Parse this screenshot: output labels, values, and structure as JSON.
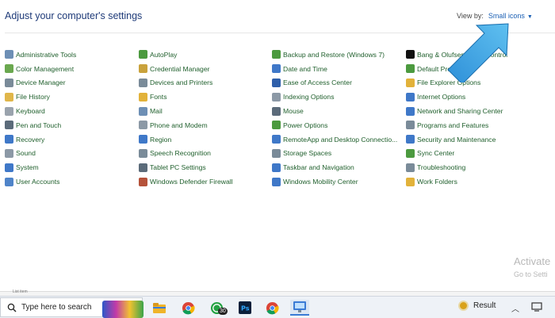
{
  "header": {
    "title": "Adjust your computer's settings"
  },
  "view_by": {
    "label": "View by:",
    "value": "Small icons"
  },
  "columns": [
    {
      "items": [
        {
          "label": "Administrative Tools",
          "icon": "admin-tools-icon",
          "color": "#6d8fb5"
        },
        {
          "label": "Color Management",
          "icon": "color-management-icon",
          "color": "#6aa84f"
        },
        {
          "label": "Device Manager",
          "icon": "device-manager-icon",
          "color": "#7a8b99"
        },
        {
          "label": "File History",
          "icon": "file-history-icon",
          "color": "#e0b64a"
        },
        {
          "label": "Keyboard",
          "icon": "keyboard-icon",
          "color": "#9aa3ad"
        },
        {
          "label": "Pen and Touch",
          "icon": "pen-icon",
          "color": "#5b6b7a"
        },
        {
          "label": "Recovery",
          "icon": "recovery-icon",
          "color": "#3f78c8"
        },
        {
          "label": "Sound",
          "icon": "sound-icon",
          "color": "#8c99a6"
        },
        {
          "label": "System",
          "icon": "system-icon",
          "color": "#3f78c8"
        },
        {
          "label": "User Accounts",
          "icon": "user-accounts-icon",
          "color": "#4f84c9"
        }
      ]
    },
    {
      "items": [
        {
          "label": "AutoPlay",
          "icon": "autoplay-icon",
          "color": "#4c9a3f"
        },
        {
          "label": "Credential Manager",
          "icon": "credential-manager-icon",
          "color": "#c9a23c"
        },
        {
          "label": "Devices and Printers",
          "icon": "printer-icon",
          "color": "#7a8b99"
        },
        {
          "label": "Fonts",
          "icon": "fonts-icon",
          "color": "#e2b23a"
        },
        {
          "label": "Mail",
          "icon": "mail-icon",
          "color": "#6d8fb5"
        },
        {
          "label": "Phone and Modem",
          "icon": "phone-icon",
          "color": "#8c99a6"
        },
        {
          "label": "Region",
          "icon": "region-icon",
          "color": "#3f78c8"
        },
        {
          "label": "Speech Recognition",
          "icon": "microphone-icon",
          "color": "#7a8b99"
        },
        {
          "label": "Tablet PC Settings",
          "icon": "tablet-icon",
          "color": "#5b6b7a"
        },
        {
          "label": "Windows Defender Firewall",
          "icon": "firewall-icon",
          "color": "#b5523a"
        }
      ]
    },
    {
      "items": [
        {
          "label": "Backup and Restore (Windows 7)",
          "icon": "backup-icon",
          "color": "#4c9a3f"
        },
        {
          "label": "Date and Time",
          "icon": "clock-icon",
          "color": "#3f78c8"
        },
        {
          "label": "Ease of Access Center",
          "icon": "ease-of-access-icon",
          "color": "#2f5faa"
        },
        {
          "label": "Indexing Options",
          "icon": "indexing-icon",
          "color": "#8c99a6"
        },
        {
          "label": "Mouse",
          "icon": "mouse-icon",
          "color": "#5b6b7a"
        },
        {
          "label": "Power Options",
          "icon": "power-icon",
          "color": "#4c9a3f"
        },
        {
          "label": "RemoteApp and Desktop Connectio...",
          "icon": "remote-desktop-icon",
          "color": "#3f78c8"
        },
        {
          "label": "Storage Spaces",
          "icon": "storage-icon",
          "color": "#7a8b99"
        },
        {
          "label": "Taskbar and Navigation",
          "icon": "taskbar-icon",
          "color": "#3f78c8"
        },
        {
          "label": "Windows Mobility Center",
          "icon": "mobility-center-icon",
          "color": "#3f78c8"
        }
      ]
    },
    {
      "items": [
        {
          "label": "Bang & Olufsen Audio Control",
          "icon": "bang-olufsen-icon",
          "color": "#222222"
        },
        {
          "label": "Default Programs",
          "icon": "default-programs-icon",
          "color": "#4c9a3f"
        },
        {
          "label": "File Explorer Options",
          "icon": "folder-icon",
          "color": "#e2b23a"
        },
        {
          "label": "Internet Options",
          "icon": "internet-icon",
          "color": "#3f78c8"
        },
        {
          "label": "Network and Sharing Center",
          "icon": "network-icon",
          "color": "#3f78c8"
        },
        {
          "label": "Programs and Features",
          "icon": "programs-icon",
          "color": "#7a8b99"
        },
        {
          "label": "Security and Maintenance",
          "icon": "flag-icon",
          "color": "#3f78c8"
        },
        {
          "label": "Sync Center",
          "icon": "sync-icon",
          "color": "#4c9a3f"
        },
        {
          "label": "Troubleshooting",
          "icon": "troubleshooting-icon",
          "color": "#7a8b99"
        },
        {
          "label": "Work Folders",
          "icon": "work-folders-icon",
          "color": "#e2b23a"
        }
      ]
    }
  ],
  "watermark": {
    "line1": "Activate",
    "line2": "Go to Setti"
  },
  "strip": {
    "text": "List item"
  },
  "taskbar": {
    "search_placeholder": "Type here to search",
    "whatsapp_badge": "30",
    "weather_text": "Result"
  }
}
